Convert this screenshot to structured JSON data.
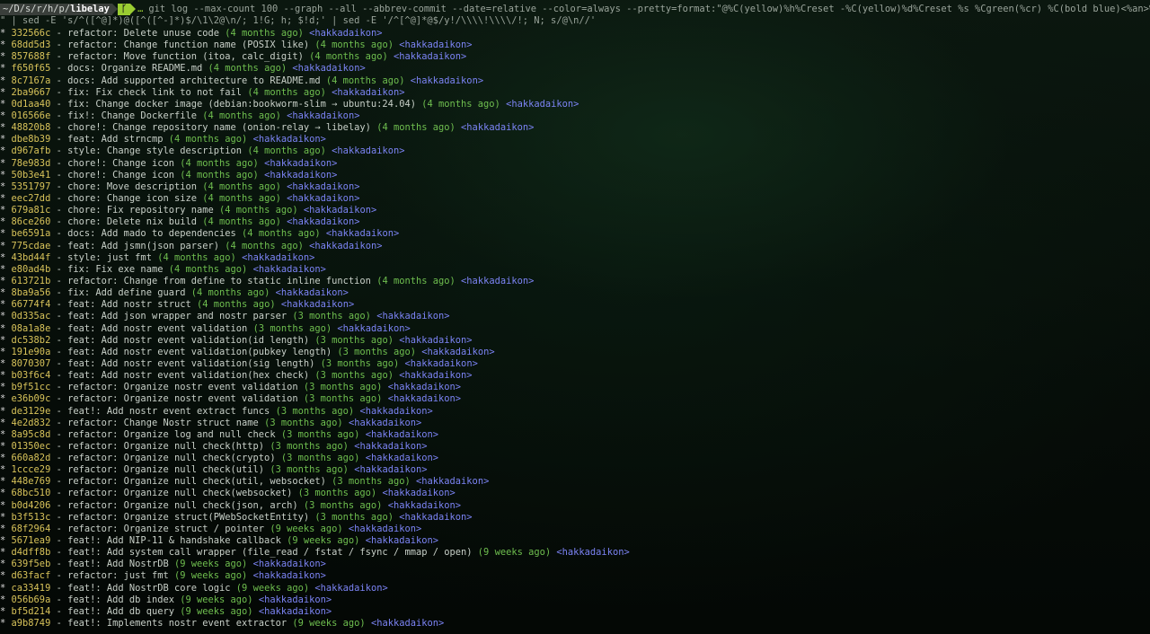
{
  "terminal": {
    "prompt": {
      "path_prefix": "~/D/s/r/h/p/",
      "path_current": "libelay",
      "git_segment": "ᚴ",
      "trail": "…",
      "command": "git log --max-count 100 --graph --all --abbrev-commit --date=relative --color=always --pretty=format:\"@%C(yellow)%h%Creset -%C(yellow)%d%Creset %s %Cgreen(%cr) %C(bold blue)<%an>%Creset"
    },
    "continuation": "\" | sed -E 's/^([^@]*)@([^([^-]*)$/\\1\\2@\\n/; 1!G; h; $!d;' | sed -E '/^[^@]*@$/y!/\\\\\\\\!\\\\\\\\/!; N; s/@\\n//'",
    "graph_char": "*",
    "commits": [
      {
        "hash": "332566c",
        "subject": "refactor: Delete unuse code",
        "date": "(4 months ago)",
        "author": "<hakkadaikon>"
      },
      {
        "hash": "68dd5d3",
        "subject": "refactor: Change function name (POSIX like)",
        "date": "(4 months ago)",
        "author": "<hakkadaikon>"
      },
      {
        "hash": "857688f",
        "subject": "refactor: Move function (itoa, calc_digit)",
        "date": "(4 months ago)",
        "author": "<hakkadaikon>"
      },
      {
        "hash": "f650f65",
        "subject": "docs: Organize README.md",
        "date": "(4 months ago)",
        "author": "<hakkadaikon>"
      },
      {
        "hash": "8c7167a",
        "subject": "docs: Add supported architecture to README.md",
        "date": "(4 months ago)",
        "author": "<hakkadaikon>"
      },
      {
        "hash": "2ba9667",
        "subject": "fix: Fix check link to not fail",
        "date": "(4 months ago)",
        "author": "<hakkadaikon>"
      },
      {
        "hash": "0d1aa40",
        "subject": "fix: Change docker image (debian:bookworm-slim → ubuntu:24.04)",
        "date": "(4 months ago)",
        "author": "<hakkadaikon>"
      },
      {
        "hash": "016566e",
        "subject": "fix!: Change Dockerfile",
        "date": "(4 months ago)",
        "author": "<hakkadaikon>"
      },
      {
        "hash": "48820b8",
        "subject": "chore!: Change repository name (onion-relay → libelay)",
        "date": "(4 months ago)",
        "author": "<hakkadaikon>"
      },
      {
        "hash": "dbe8b39",
        "subject": "feat: Add strncmp",
        "date": "(4 months ago)",
        "author": "<hakkadaikon>"
      },
      {
        "hash": "d967afb",
        "subject": "style: Change style description",
        "date": "(4 months ago)",
        "author": "<hakkadaikon>"
      },
      {
        "hash": "78e983d",
        "subject": "chore!: Change icon",
        "date": "(4 months ago)",
        "author": "<hakkadaikon>"
      },
      {
        "hash": "50b3e41",
        "subject": "chore!: Change icon",
        "date": "(4 months ago)",
        "author": "<hakkadaikon>"
      },
      {
        "hash": "5351797",
        "subject": "chore: Move description",
        "date": "(4 months ago)",
        "author": "<hakkadaikon>"
      },
      {
        "hash": "eec27dd",
        "subject": "chore: Change icon size",
        "date": "(4 months ago)",
        "author": "<hakkadaikon>"
      },
      {
        "hash": "679a81c",
        "subject": "chore: Fix repository name",
        "date": "(4 months ago)",
        "author": "<hakkadaikon>"
      },
      {
        "hash": "86ce260",
        "subject": "chore: Delete nix build",
        "date": "(4 months ago)",
        "author": "<hakkadaikon>"
      },
      {
        "hash": "be6591a",
        "subject": "docs: Add mado to dependencies",
        "date": "(4 months ago)",
        "author": "<hakkadaikon>"
      },
      {
        "hash": "775cdae",
        "subject": "feat: Add jsmn(json parser)",
        "date": "(4 months ago)",
        "author": "<hakkadaikon>"
      },
      {
        "hash": "43bd44f",
        "subject": "style: just fmt",
        "date": "(4 months ago)",
        "author": "<hakkadaikon>"
      },
      {
        "hash": "e80ad4b",
        "subject": "fix: Fix exe name",
        "date": "(4 months ago)",
        "author": "<hakkadaikon>"
      },
      {
        "hash": "613721b",
        "subject": "refactor: Change from define to static inline function",
        "date": "(4 months ago)",
        "author": "<hakkadaikon>"
      },
      {
        "hash": "8ba9a56",
        "subject": "fix: Add define guard",
        "date": "(4 months ago)",
        "author": "<hakkadaikon>"
      },
      {
        "hash": "66774f4",
        "subject": "feat: Add nostr struct",
        "date": "(4 months ago)",
        "author": "<hakkadaikon>"
      },
      {
        "hash": "0d335ac",
        "subject": "feat: Add json wrapper and nostr parser",
        "date": "(3 months ago)",
        "author": "<hakkadaikon>"
      },
      {
        "hash": "08a1a8e",
        "subject": "feat: Add nostr event validation",
        "date": "(3 months ago)",
        "author": "<hakkadaikon>"
      },
      {
        "hash": "dc538b2",
        "subject": "feat: Add nostr event validation(id length)",
        "date": "(3 months ago)",
        "author": "<hakkadaikon>"
      },
      {
        "hash": "191e90a",
        "subject": "feat: Add nostr event validation(pubkey length)",
        "date": "(3 months ago)",
        "author": "<hakkadaikon>"
      },
      {
        "hash": "8070307",
        "subject": "feat: Add nostr event validation(sig length)",
        "date": "(3 months ago)",
        "author": "<hakkadaikon>"
      },
      {
        "hash": "b03f6c4",
        "subject": "feat: Add nostr event validation(hex check)",
        "date": "(3 months ago)",
        "author": "<hakkadaikon>"
      },
      {
        "hash": "b9f51cc",
        "subject": "refactor: Organize nostr event validation",
        "date": "(3 months ago)",
        "author": "<hakkadaikon>"
      },
      {
        "hash": "e36b09c",
        "subject": "refactor: Organize nostr event validation",
        "date": "(3 months ago)",
        "author": "<hakkadaikon>"
      },
      {
        "hash": "de3129e",
        "subject": "feat!: Add nostr event extract funcs",
        "date": "(3 months ago)",
        "author": "<hakkadaikon>"
      },
      {
        "hash": "4e2d832",
        "subject": "refactor: Change Nostr struct name",
        "date": "(3 months ago)",
        "author": "<hakkadaikon>"
      },
      {
        "hash": "8a95c8d",
        "subject": "refactor: Organize log and null check",
        "date": "(3 months ago)",
        "author": "<hakkadaikon>"
      },
      {
        "hash": "01350ec",
        "subject": "refactor: Organize null check(http)",
        "date": "(3 months ago)",
        "author": "<hakkadaikon>"
      },
      {
        "hash": "660a82d",
        "subject": "refactor: Organize null check(crypto)",
        "date": "(3 months ago)",
        "author": "<hakkadaikon>"
      },
      {
        "hash": "1ccce29",
        "subject": "refactor: Organize null check(util)",
        "date": "(3 months ago)",
        "author": "<hakkadaikon>"
      },
      {
        "hash": "448e769",
        "subject": "refactor: Organize null check(util, websocket)",
        "date": "(3 months ago)",
        "author": "<hakkadaikon>"
      },
      {
        "hash": "68bc510",
        "subject": "refactor: Organize null check(websocket)",
        "date": "(3 months ago)",
        "author": "<hakkadaikon>"
      },
      {
        "hash": "b0d4206",
        "subject": "refactor: Organize null check(json, arch)",
        "date": "(3 months ago)",
        "author": "<hakkadaikon>"
      },
      {
        "hash": "b3f513c",
        "subject": "refactor: Organize struct(PWebSocketEntity)",
        "date": "(3 months ago)",
        "author": "<hakkadaikon>"
      },
      {
        "hash": "68f2964",
        "subject": "refactor: Organize struct / pointer",
        "date": "(9 weeks ago)",
        "author": "<hakkadaikon>"
      },
      {
        "hash": "5671ea9",
        "subject": "feat!: Add NIP-11 & handshake callback",
        "date": "(9 weeks ago)",
        "author": "<hakkadaikon>"
      },
      {
        "hash": "d4dff8b",
        "subject": "feat!: Add system call wrapper (file_read / fstat / fsync / mmap / open)",
        "date": "(9 weeks ago)",
        "author": "<hakkadaikon>"
      },
      {
        "hash": "639f5eb",
        "subject": "feat!: Add NostrDB",
        "date": "(9 weeks ago)",
        "author": "<hakkadaikon>"
      },
      {
        "hash": "d63facf",
        "subject": "refactor: just fmt",
        "date": "(9 weeks ago)",
        "author": "<hakkadaikon>"
      },
      {
        "hash": "ca33419",
        "subject": "feat!: Add NostrDB core logic",
        "date": "(9 weeks ago)",
        "author": "<hakkadaikon>"
      },
      {
        "hash": "056b69a",
        "subject": "feat!: Add db index",
        "date": "(9 weeks ago)",
        "author": "<hakkadaikon>"
      },
      {
        "hash": "bf5d214",
        "subject": "feat!: Add db query",
        "date": "(9 weeks ago)",
        "author": "<hakkadaikon>"
      },
      {
        "hash": "a9b8749",
        "subject": "feat!: Implements nostr event extractor",
        "date": "(9 weeks ago)",
        "author": "<hakkadaikon>"
      }
    ]
  },
  "colors": {
    "hash": "#d8c35a",
    "date": "#6fbf4f",
    "author": "#7c84f5",
    "prompt_git": "#9acd32",
    "prompt_path_bg": "#3a3f3b"
  }
}
